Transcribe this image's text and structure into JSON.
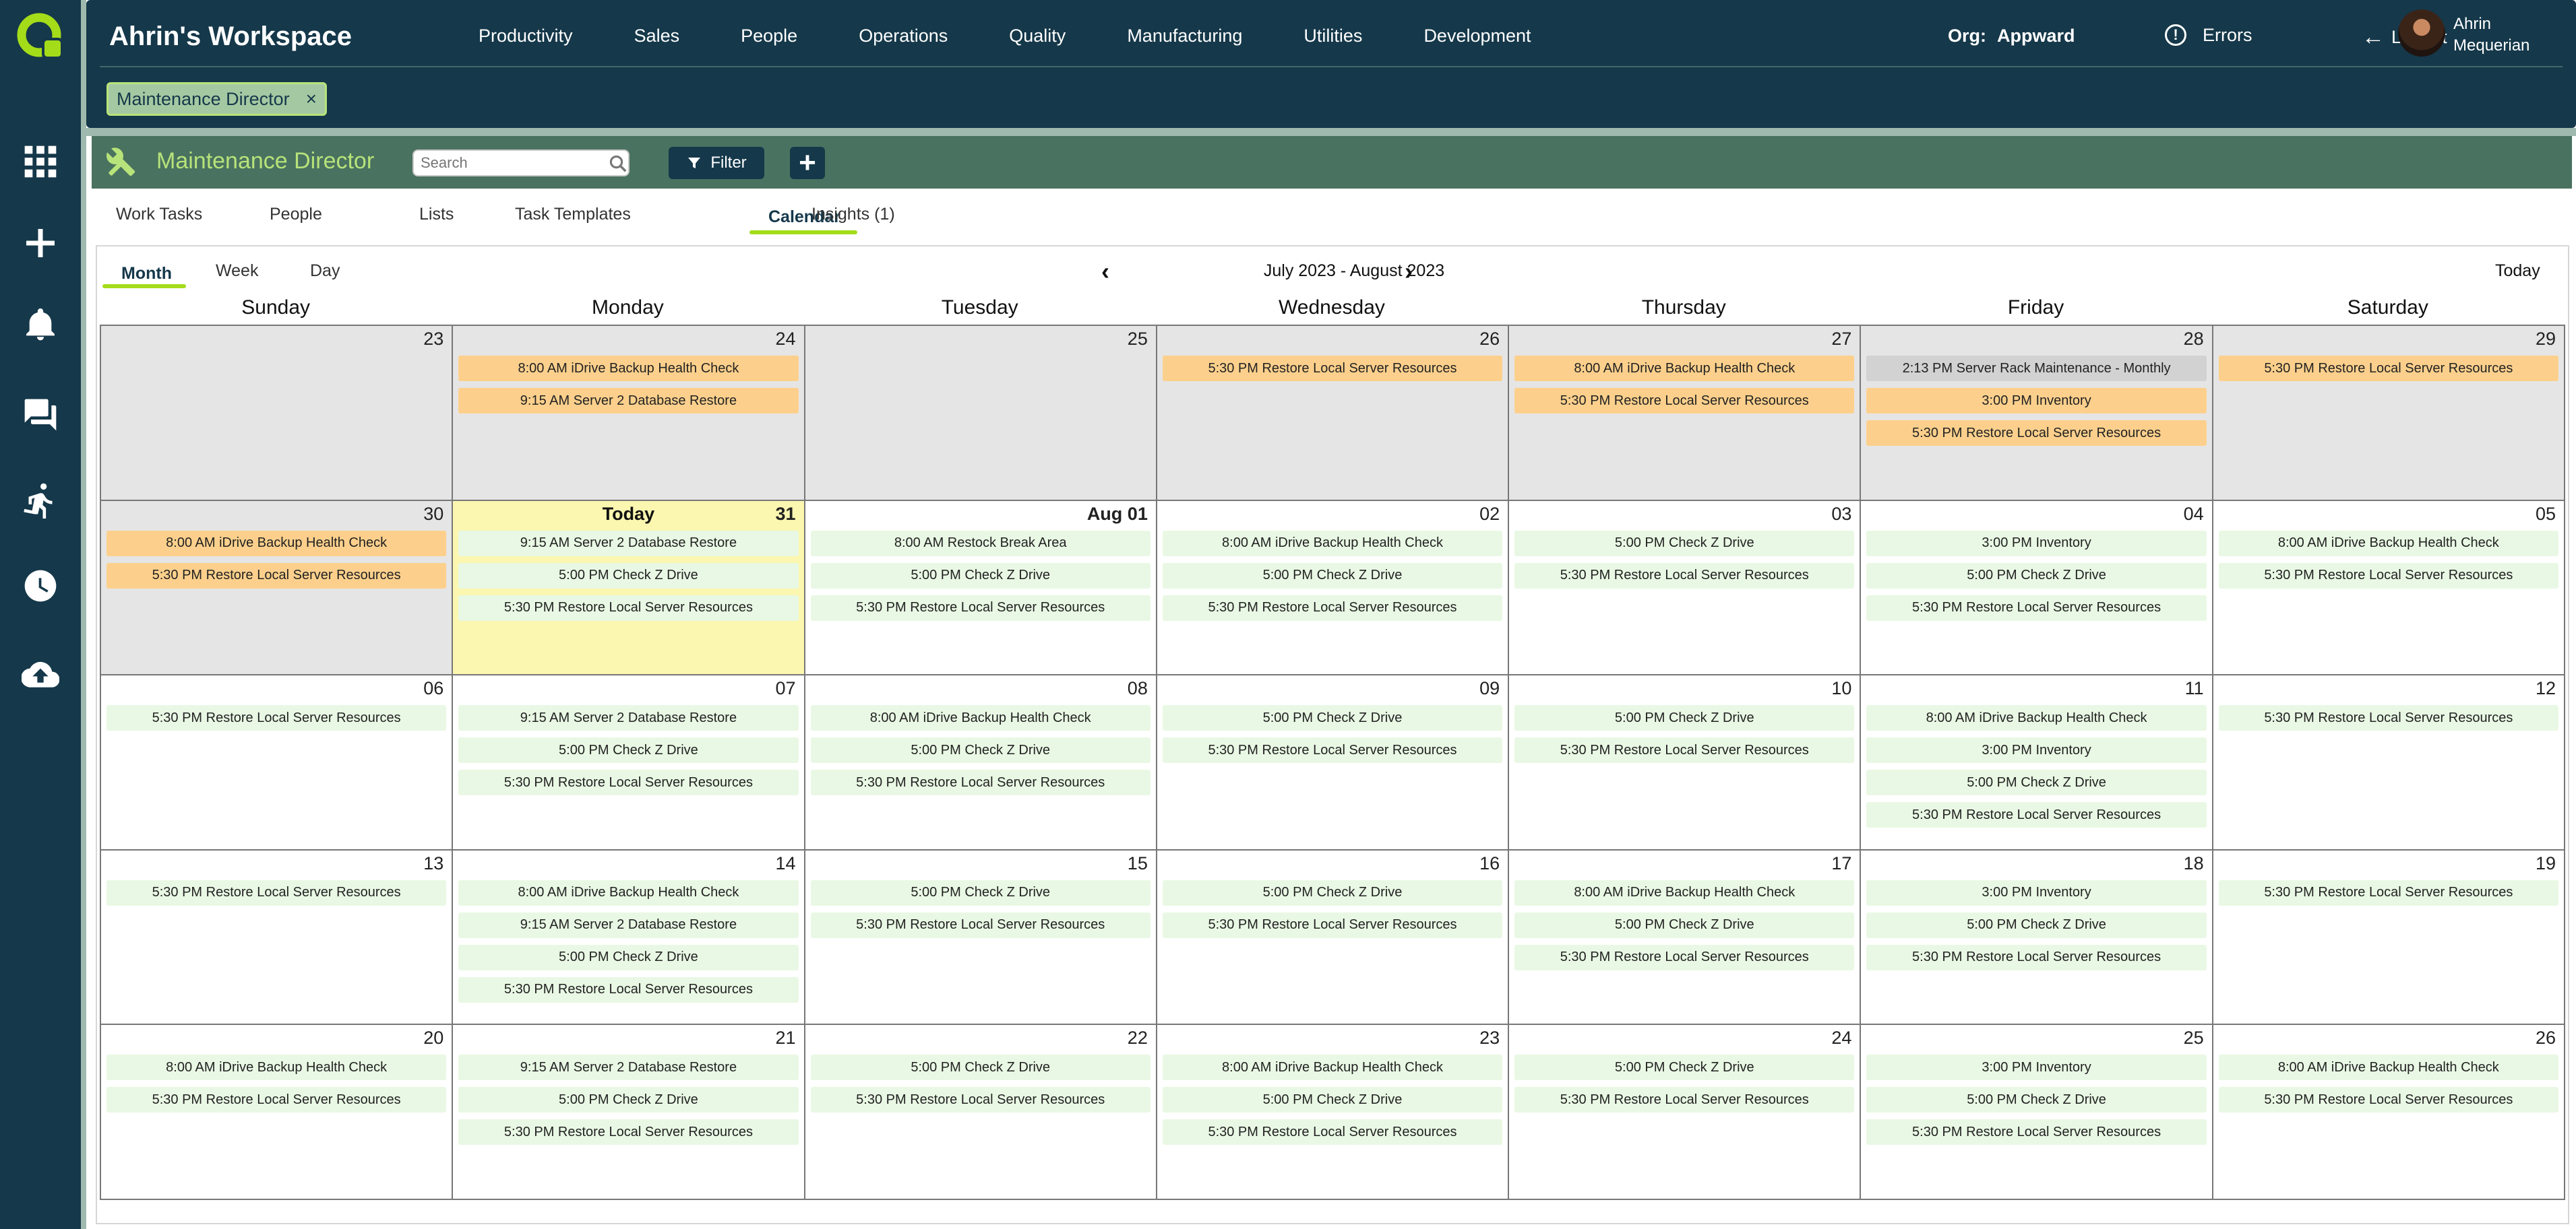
{
  "app": {
    "workspace_title": "Ahrin's Workspace",
    "nav": [
      "Productivity",
      "Sales",
      "People",
      "Operations",
      "Quality",
      "Manufacturing",
      "Utilities",
      "Development"
    ],
    "org_label": "Org:",
    "org_value": "Appward",
    "errors_label": "Errors",
    "logout_label": "Logout",
    "user_name": "Ahrin Mequerian",
    "chip_label": "Maintenance Director",
    "chip_close": "×"
  },
  "rail_icons": [
    "apps-grid-icon",
    "plus-icon",
    "bell-icon",
    "chat-icon",
    "runner-icon",
    "clock-icon",
    "cloud-upload-icon"
  ],
  "section": {
    "title": "Maintenance Director",
    "search_placeholder": "Search",
    "filter_label": "Filter",
    "add_label": "+"
  },
  "tabs": [
    "Work Tasks",
    "People",
    "Lists",
    "Task Templates",
    "Calendar",
    "Insights (1)"
  ],
  "active_tab": "Calendar",
  "calendar": {
    "view_tabs": [
      "Month",
      "Week",
      "Day"
    ],
    "active_view": "Month",
    "range_label": "July 2023 - August 2023",
    "prev": "‹",
    "next": "›",
    "today_button": "Today",
    "today_label": "Today",
    "weekdays": [
      "Sunday",
      "Monday",
      "Tuesday",
      "Wednesday",
      "Thursday",
      "Friday",
      "Saturday"
    ],
    "weeks": [
      [
        {
          "day": "23",
          "other": true,
          "events": []
        },
        {
          "day": "24",
          "other": true,
          "events": [
            {
              "text": "8:00 AM iDrive Backup Health Check",
              "color": "orange"
            },
            {
              "text": "9:15 AM Server 2 Database Restore",
              "color": "orange"
            }
          ]
        },
        {
          "day": "25",
          "other": true,
          "events": []
        },
        {
          "day": "26",
          "other": true,
          "events": [
            {
              "text": "5:30 PM Restore Local Server Resources",
              "color": "orange"
            }
          ]
        },
        {
          "day": "27",
          "other": true,
          "events": [
            {
              "text": "8:00 AM iDrive Backup Health Check",
              "color": "orange"
            },
            {
              "text": "5:30 PM Restore Local Server Resources",
              "color": "orange"
            }
          ]
        },
        {
          "day": "28",
          "other": true,
          "events": [
            {
              "text": "2:13 PM Server Rack Maintenance - Monthly",
              "color": "grey"
            },
            {
              "text": "3:00 PM Inventory",
              "color": "orange"
            },
            {
              "text": "5:30 PM Restore Local Server Resources",
              "color": "orange"
            }
          ]
        },
        {
          "day": "29",
          "other": true,
          "events": [
            {
              "text": "5:30 PM Restore Local Server Resources",
              "color": "orange"
            }
          ]
        }
      ],
      [
        {
          "day": "30",
          "other": true,
          "events": [
            {
              "text": "8:00 AM iDrive Backup Health Check",
              "color": "orange"
            },
            {
              "text": "5:30 PM Restore Local Server Resources",
              "color": "orange"
            }
          ]
        },
        {
          "day": "31",
          "today": true,
          "events": [
            {
              "text": "9:15 AM Server 2 Database Restore",
              "color": "green"
            },
            {
              "text": "5:00 PM Check Z Drive",
              "color": "green"
            },
            {
              "text": "5:30 PM Restore Local Server Resources",
              "color": "green"
            }
          ]
        },
        {
          "day": "Aug 01",
          "bold": true,
          "events": [
            {
              "text": "8:00 AM Restock Break Area",
              "color": "green"
            },
            {
              "text": "5:00 PM Check Z Drive",
              "color": "green"
            },
            {
              "text": "5:30 PM Restore Local Server Resources",
              "color": "green"
            }
          ]
        },
        {
          "day": "02",
          "events": [
            {
              "text": "8:00 AM iDrive Backup Health Check",
              "color": "green"
            },
            {
              "text": "5:00 PM Check Z Drive",
              "color": "green"
            },
            {
              "text": "5:30 PM Restore Local Server Resources",
              "color": "green"
            }
          ]
        },
        {
          "day": "03",
          "events": [
            {
              "text": "5:00 PM Check Z Drive",
              "color": "green"
            },
            {
              "text": "5:30 PM Restore Local Server Resources",
              "color": "green"
            }
          ]
        },
        {
          "day": "04",
          "events": [
            {
              "text": "3:00 PM Inventory",
              "color": "green"
            },
            {
              "text": "5:00 PM Check Z Drive",
              "color": "green"
            },
            {
              "text": "5:30 PM Restore Local Server Resources",
              "color": "green"
            }
          ]
        },
        {
          "day": "05",
          "events": [
            {
              "text": "8:00 AM iDrive Backup Health Check",
              "color": "green"
            },
            {
              "text": "5:30 PM Restore Local Server Resources",
              "color": "green"
            }
          ]
        }
      ],
      [
        {
          "day": "06",
          "events": [
            {
              "text": "5:30 PM Restore Local Server Resources",
              "color": "green"
            }
          ]
        },
        {
          "day": "07",
          "events": [
            {
              "text": "9:15 AM Server 2 Database Restore",
              "color": "green"
            },
            {
              "text": "5:00 PM Check Z Drive",
              "color": "green"
            },
            {
              "text": "5:30 PM Restore Local Server Resources",
              "color": "green"
            }
          ]
        },
        {
          "day": "08",
          "events": [
            {
              "text": "8:00 AM iDrive Backup Health Check",
              "color": "green"
            },
            {
              "text": "5:00 PM Check Z Drive",
              "color": "green"
            },
            {
              "text": "5:30 PM Restore Local Server Resources",
              "color": "green"
            }
          ]
        },
        {
          "day": "09",
          "events": [
            {
              "text": "5:00 PM Check Z Drive",
              "color": "green"
            },
            {
              "text": "5:30 PM Restore Local Server Resources",
              "color": "green"
            }
          ]
        },
        {
          "day": "10",
          "events": [
            {
              "text": "5:00 PM Check Z Drive",
              "color": "green"
            },
            {
              "text": "5:30 PM Restore Local Server Resources",
              "color": "green"
            }
          ]
        },
        {
          "day": "11",
          "events": [
            {
              "text": "8:00 AM iDrive Backup Health Check",
              "color": "green"
            },
            {
              "text": "3:00 PM Inventory",
              "color": "green"
            },
            {
              "text": "5:00 PM Check Z Drive",
              "color": "green"
            },
            {
              "text": "5:30 PM Restore Local Server Resources",
              "color": "green"
            }
          ]
        },
        {
          "day": "12",
          "events": [
            {
              "text": "5:30 PM Restore Local Server Resources",
              "color": "green"
            }
          ]
        }
      ],
      [
        {
          "day": "13",
          "events": [
            {
              "text": "5:30 PM Restore Local Server Resources",
              "color": "green"
            }
          ]
        },
        {
          "day": "14",
          "events": [
            {
              "text": "8:00 AM iDrive Backup Health Check",
              "color": "green"
            },
            {
              "text": "9:15 AM Server 2 Database Restore",
              "color": "green"
            },
            {
              "text": "5:00 PM Check Z Drive",
              "color": "green"
            },
            {
              "text": "5:30 PM Restore Local Server Resources",
              "color": "green"
            }
          ]
        },
        {
          "day": "15",
          "events": [
            {
              "text": "5:00 PM Check Z Drive",
              "color": "green"
            },
            {
              "text": "5:30 PM Restore Local Server Resources",
              "color": "green"
            }
          ]
        },
        {
          "day": "16",
          "events": [
            {
              "text": "5:00 PM Check Z Drive",
              "color": "green"
            },
            {
              "text": "5:30 PM Restore Local Server Resources",
              "color": "green"
            }
          ]
        },
        {
          "day": "17",
          "events": [
            {
              "text": "8:00 AM iDrive Backup Health Check",
              "color": "green"
            },
            {
              "text": "5:00 PM Check Z Drive",
              "color": "green"
            },
            {
              "text": "5:30 PM Restore Local Server Resources",
              "color": "green"
            }
          ]
        },
        {
          "day": "18",
          "events": [
            {
              "text": "3:00 PM Inventory",
              "color": "green"
            },
            {
              "text": "5:00 PM Check Z Drive",
              "color": "green"
            },
            {
              "text": "5:30 PM Restore Local Server Resources",
              "color": "green"
            }
          ]
        },
        {
          "day": "19",
          "events": [
            {
              "text": "5:30 PM Restore Local Server Resources",
              "color": "green"
            }
          ]
        }
      ],
      [
        {
          "day": "20",
          "events": [
            {
              "text": "8:00 AM iDrive Backup Health Check",
              "color": "green"
            },
            {
              "text": "5:30 PM Restore Local Server Resources",
              "color": "green"
            }
          ]
        },
        {
          "day": "21",
          "events": [
            {
              "text": "9:15 AM Server 2 Database Restore",
              "color": "green"
            },
            {
              "text": "5:00 PM Check Z Drive",
              "color": "green"
            },
            {
              "text": "5:30 PM Restore Local Server Resources",
              "color": "green"
            }
          ]
        },
        {
          "day": "22",
          "events": [
            {
              "text": "5:00 PM Check Z Drive",
              "color": "green"
            },
            {
              "text": "5:30 PM Restore Local Server Resources",
              "color": "green"
            }
          ]
        },
        {
          "day": "23",
          "events": [
            {
              "text": "8:00 AM iDrive Backup Health Check",
              "color": "green"
            },
            {
              "text": "5:00 PM Check Z Drive",
              "color": "green"
            },
            {
              "text": "5:30 PM Restore Local Server Resources",
              "color": "green"
            }
          ]
        },
        {
          "day": "24",
          "events": [
            {
              "text": "5:00 PM Check Z Drive",
              "color": "green"
            },
            {
              "text": "5:30 PM Restore Local Server Resources",
              "color": "green"
            }
          ]
        },
        {
          "day": "25",
          "events": [
            {
              "text": "3:00 PM Inventory",
              "color": "green"
            },
            {
              "text": "5:00 PM Check Z Drive",
              "color": "green"
            },
            {
              "text": "5:30 PM Restore Local Server Resources",
              "color": "green"
            }
          ]
        },
        {
          "day": "26",
          "events": [
            {
              "text": "8:00 AM iDrive Backup Health Check",
              "color": "green"
            },
            {
              "text": "5:30 PM Restore Local Server Resources",
              "color": "green"
            }
          ]
        }
      ]
    ]
  },
  "colors": {
    "header_bg": "#15384a",
    "section_bg": "#4a7260",
    "accent_green": "#a4dc1a",
    "event_orange": "#fcd08c",
    "event_green": "#e9f8e4",
    "event_grey": "#d2d2d2",
    "other_month_bg": "#e5e5e5",
    "today_bg": "#fbf7b0"
  }
}
